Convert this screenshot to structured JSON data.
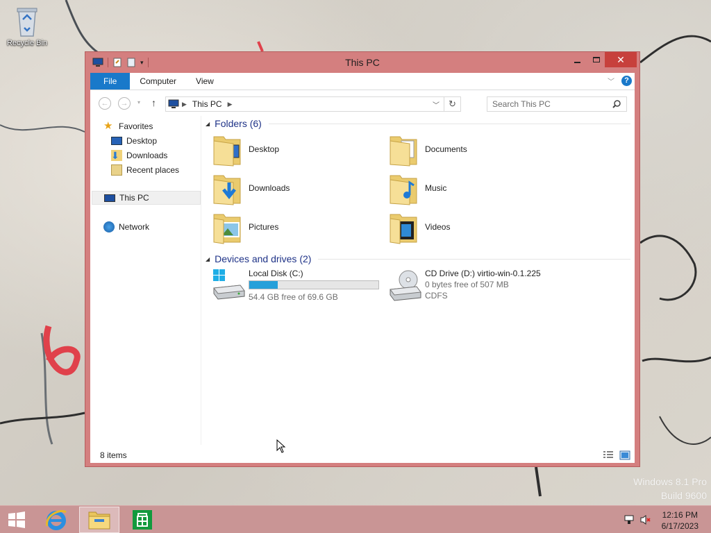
{
  "desktop": {
    "recycle_bin_label": "Recycle Bin",
    "watermark_line1": "Windows 8.1 Pro",
    "watermark_line2": "Build 9600"
  },
  "window": {
    "title": "This PC",
    "ribbon_tabs": [
      "File",
      "Computer",
      "View"
    ],
    "address": {
      "crumb": "This PC"
    },
    "search_placeholder": "Search This PC",
    "status": {
      "item_count": "8 items"
    }
  },
  "nav_pane": {
    "favorites": "Favorites",
    "desktop": "Desktop",
    "downloads": "Downloads",
    "recent_places": "Recent places",
    "this_pc": "This PC",
    "network": "Network"
  },
  "folders_group": {
    "header": "Folders (6)",
    "items": [
      "Desktop",
      "Documents",
      "Downloads",
      "Music",
      "Pictures",
      "Videos"
    ]
  },
  "devices_group": {
    "header": "Devices and drives (2)",
    "local_disk": {
      "name": "Local Disk (C:)",
      "free_text": "54.4 GB free of 69.6 GB",
      "used_fraction": 0.22
    },
    "cd_drive": {
      "name": "CD Drive (D:) virtio-win-0.1.225",
      "free_text": "0 bytes free of 507 MB",
      "fs": "CDFS"
    }
  },
  "taskbar": {
    "time": "12:16 PM",
    "date": "6/17/2023"
  },
  "colors": {
    "accent": "#1979ca",
    "window_frame": "#d47f7f",
    "close_button": "#c7403c",
    "taskbar": "#c99595",
    "drive_fill": "#26a0da"
  }
}
